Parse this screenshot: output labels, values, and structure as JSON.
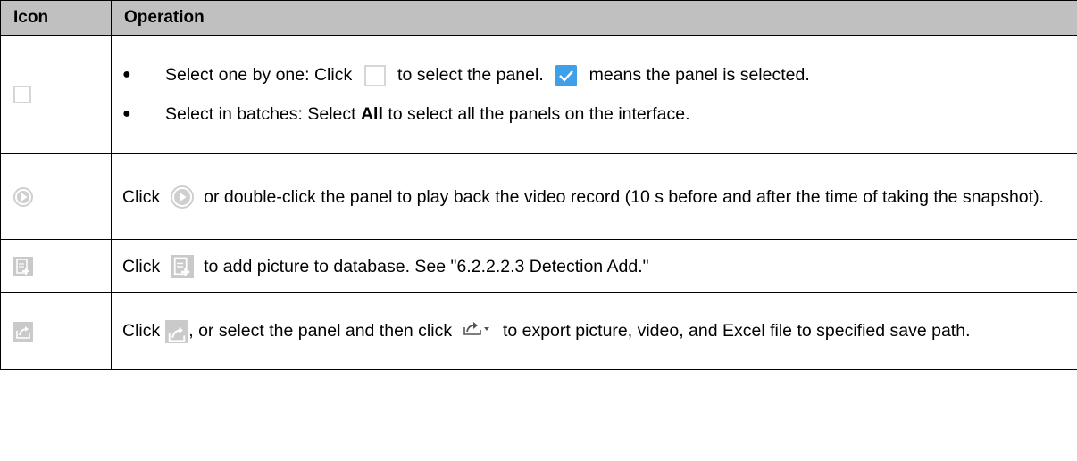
{
  "header": {
    "icon_col": "Icon",
    "op_col": "Operation"
  },
  "rows": [
    {
      "icon": "checkbox-unchecked-icon",
      "bullets": [
        {
          "pre": "Select one by one: Click",
          "mid": "to select the panel.",
          "post": "means the panel is selected."
        },
        {
          "pre": "Select in batches: Select",
          "bold": "All",
          "post": "to select all the panels on the interface."
        }
      ]
    },
    {
      "icon": "play-icon",
      "pre": "Click",
      "post": "or double-click the panel to play back the video record (10 s before and after the time of taking the snapshot)."
    },
    {
      "icon": "add-to-database-icon",
      "pre": "Click",
      "post": "to add picture to database. See \"6.2.2.2.3 Detection Add.\""
    },
    {
      "icon": "export-icon",
      "pre": "Click",
      "mid": ", or select the panel and then click",
      "post": "to export picture, video, and Excel file to specified save path."
    }
  ],
  "colors": {
    "header_bg": "#c0c0c0",
    "checked_blue": "#3ea0e8",
    "icon_gray": "#cccccc"
  }
}
